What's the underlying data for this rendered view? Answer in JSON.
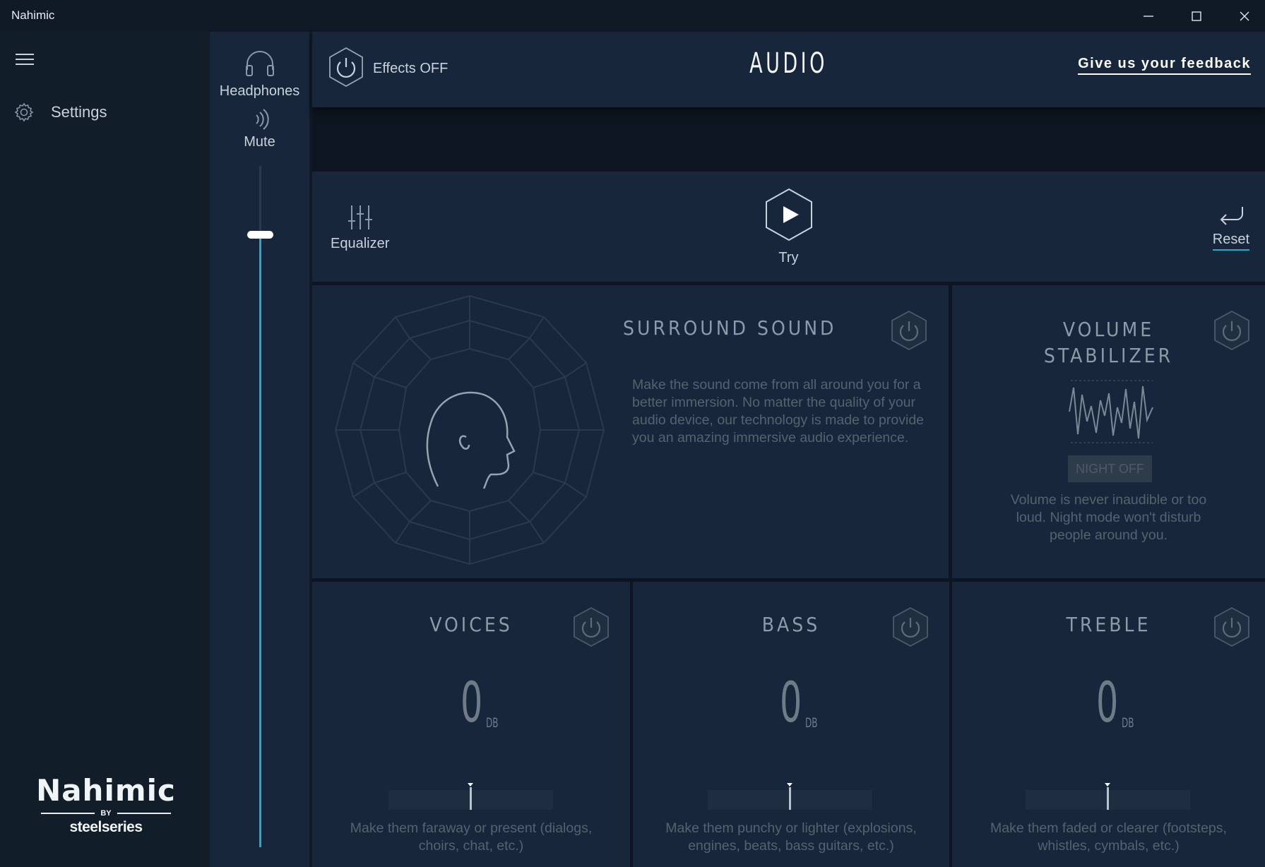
{
  "window": {
    "title": "Nahimic"
  },
  "sidebar": {
    "settings_label": "Settings",
    "logo": {
      "word": "Nahimic",
      "by": "BY",
      "brand": "steelseries"
    }
  },
  "device": {
    "headphones_label": "Headphones",
    "mute_label": "Mute",
    "volume_level": 0.9
  },
  "header": {
    "effects_label": "Effects OFF",
    "title": "AUDIO",
    "feedback_label": "Give us your feedback"
  },
  "toolbar": {
    "equalizer_label": "Equalizer",
    "try_label": "Try",
    "reset_label": "Reset"
  },
  "surround": {
    "title": "SURROUND SOUND",
    "desc": "Make the sound come from all around you for a better immersion. No matter the quality of your audio device, our technology is made to provide you an amazing immersive audio experience."
  },
  "volume_stabilizer": {
    "title_line1": "VOLUME",
    "title_line2": "STABILIZER",
    "night_label": "NIGHT OFF",
    "desc": "Volume is never inaudible or too loud. Night mode won't disturb people around you."
  },
  "voices": {
    "title": "VOICES",
    "value": "0",
    "unit": "DB",
    "desc": "Make them faraway or present (dialogs, choirs, chat, etc.)"
  },
  "bass": {
    "title": "BASS",
    "value": "0",
    "unit": "DB",
    "desc": "Make them punchy or lighter (explosions, engines, beats, bass guitars, etc.)"
  },
  "treble": {
    "title": "TREBLE",
    "value": "0",
    "unit": "DB",
    "desc": "Make them faded or clearer (footsteps, whistles, cymbals, etc.)"
  },
  "colors": {
    "accent": "#2aa6c7",
    "panel": "#17263a",
    "background": "#0d1620"
  }
}
